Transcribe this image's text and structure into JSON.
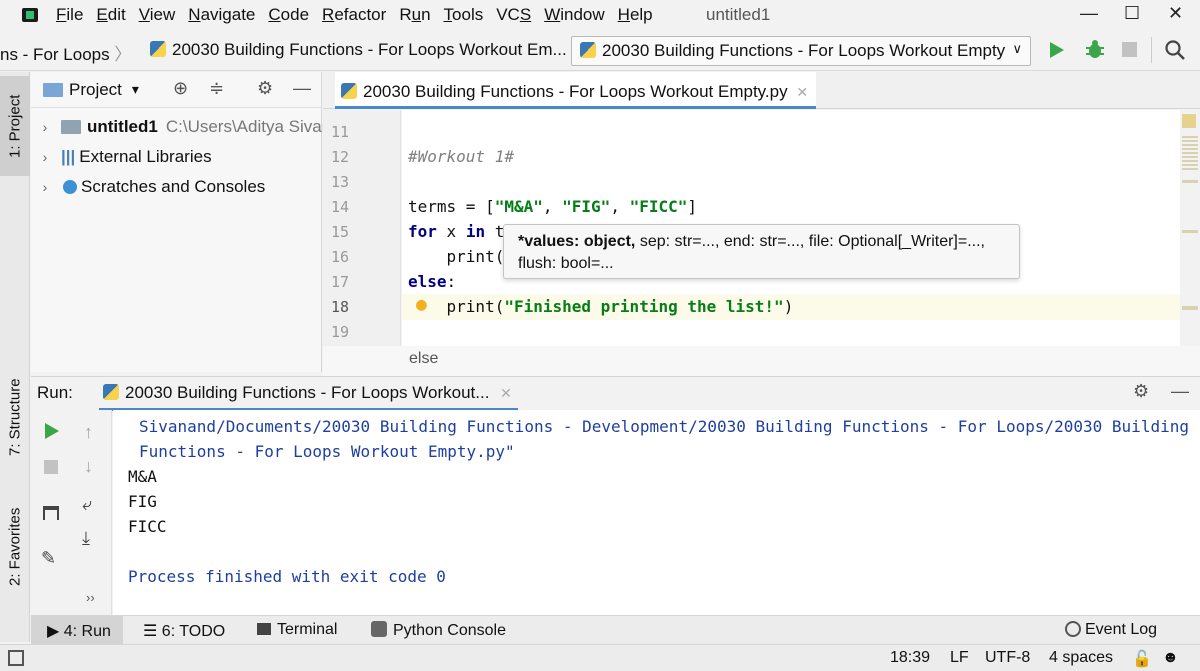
{
  "menubar": {
    "items": [
      {
        "pre": "",
        "u": "F",
        "post": "ile"
      },
      {
        "pre": "",
        "u": "E",
        "post": "dit"
      },
      {
        "pre": "",
        "u": "V",
        "post": "iew"
      },
      {
        "pre": "",
        "u": "N",
        "post": "avigate"
      },
      {
        "pre": "",
        "u": "C",
        "post": "ode"
      },
      {
        "pre": "",
        "u": "R",
        "post": "efactor"
      },
      {
        "pre": "R",
        "u": "u",
        "post": "n"
      },
      {
        "pre": "",
        "u": "T",
        "post": "ools"
      },
      {
        "pre": "VC",
        "u": "S",
        "post": ""
      },
      {
        "pre": "",
        "u": "W",
        "post": "indow"
      },
      {
        "pre": "",
        "u": "H",
        "post": "elp"
      }
    ],
    "window_title": "untitled1",
    "minimize": "—",
    "maximize": "☐",
    "close": "✕"
  },
  "navbar": {
    "breadcrumb_1": "ns - For Loops",
    "breadcrumb_sep": "〉",
    "breadcrumb_2": "20030 Building Functions - For Loops Workout Em...",
    "run_config": "20030 Building Functions - For Loops Workout Empty",
    "run_config_arrow": "∨"
  },
  "leftstrip": {
    "project": "1: Project",
    "structure": "7: Structure",
    "favorites": "2: Favorites"
  },
  "project_panel": {
    "title": "Project",
    "dropdown": "▾",
    "tree": [
      {
        "label": "untitled1",
        "path": "C:\\Users\\Aditya Sivan"
      },
      {
        "label": "External Libraries",
        "path": ""
      },
      {
        "label": "Scratches and Consoles",
        "path": ""
      }
    ]
  },
  "editor": {
    "tab": "20030 Building Functions - For Loops Workout Empty.py",
    "tab_close": "✕",
    "line_numbers": [
      "11",
      "12",
      "13",
      "14",
      "15",
      "16",
      "17",
      "18",
      "19"
    ],
    "lines": {
      "l12": "#Workout 1#",
      "l14_a": "terms = [",
      "l14_s1": "\"M&A\"",
      "l14_c1": ", ",
      "l14_s2": "\"FIG\"",
      "l14_c2": ", ",
      "l14_s3": "\"FICC\"",
      "l14_end": "]",
      "l15_kw": "for",
      "l15_mid": " x ",
      "l15_kw2": "in",
      "l15_end": " t",
      "l16": "    print(",
      "l17_kw": "else",
      "l17_end": ":",
      "l18_a": "    print(",
      "l18_s": "\"Finished printing the list!\"",
      "l18_end": ")"
    },
    "tooltip_line1_bold": "*values: object,",
    "tooltip_line1_rest": " sep: str=..., end: str=..., file: Optional[_Writer]=...,",
    "tooltip_line2": "flush: bool=...",
    "footer_breadcrumb": "else"
  },
  "run_panel": {
    "label": "Run:",
    "tab": "20030 Building Functions - For Loops Workout...",
    "tab_close": "✕",
    "console_lines": [
      "Sivanand/Documents/20030 Building Functions - Development/20030 Building Functions - For Loops/20030 Building",
      "Functions - For Loops Workout Empty.py\""
    ],
    "output": [
      "M&A",
      "FIG",
      "FICC"
    ],
    "exit_message": "Process finished with exit code 0"
  },
  "bottom_tabs": {
    "run": "4: Run",
    "todo": "6: TODO",
    "terminal": "Terminal",
    "python_console": "Python Console",
    "event_log": "Event Log"
  },
  "status_bar": {
    "position": "18:39",
    "line_sep": "LF",
    "encoding": "UTF-8",
    "indent": "4 spaces"
  }
}
